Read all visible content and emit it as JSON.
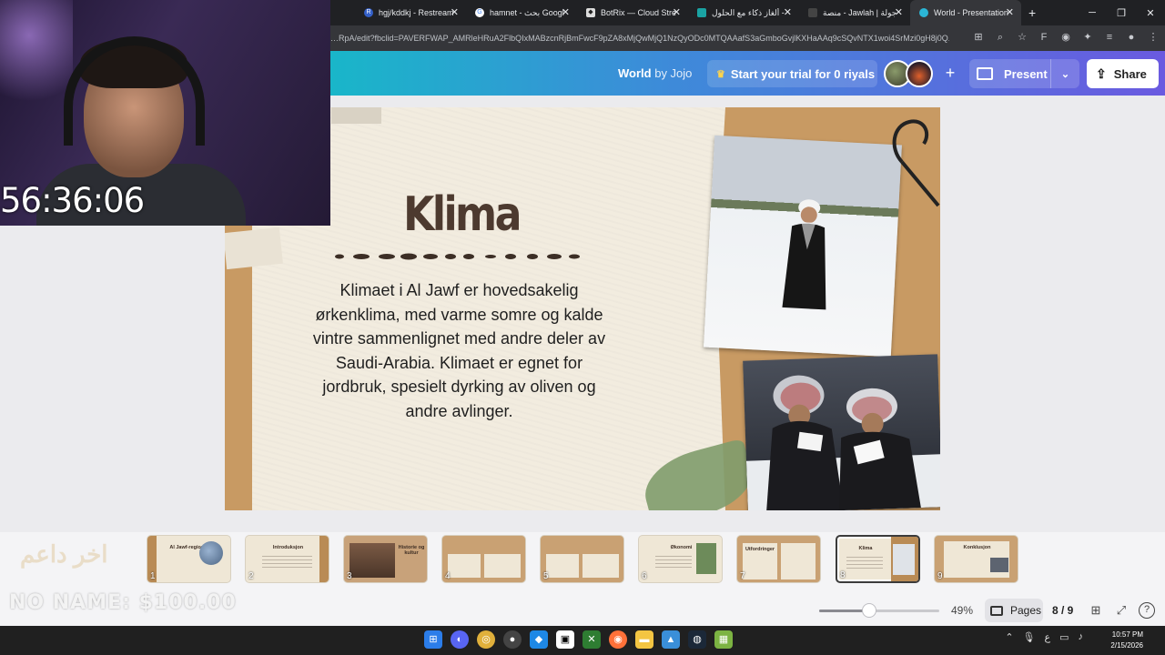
{
  "browser": {
    "tabs": [
      {
        "label": "",
        "icon": "tab-icon"
      },
      {
        "label": "hgj/kddkj - Restream",
        "icon": "restream-icon"
      },
      {
        "label": "hamnet - بحث Googl",
        "icon": "google-icon"
      },
      {
        "label": "BotRix — Cloud Stre",
        "icon": "botrix-icon"
      },
      {
        "label": "ألغاز ذكاء مع الحلول -",
        "icon": "page-icon"
      },
      {
        "label": "منصة - Jawlah | جولة",
        "icon": "jawlah-icon"
      },
      {
        "label": "World - Presentation",
        "icon": "canva-icon"
      }
    ],
    "url": "…RpA/edit?fbclid=PAVERFWAP_AMRleHRuA2FlbQIxMABzcnRjBmFwcF9pZA8xMjQwMjQ1NzQyODc0MTQAAafS3aGmboGvjlKXHaAAq9cSQvNTX1woi4SrMzi0gH8j0Q..."
  },
  "header": {
    "doc_title": "World",
    "doc_by": "by Jojo",
    "trial_label": "Start your trial for 0 riyals",
    "present_label": "Present",
    "share_label": "Share"
  },
  "slide": {
    "title": "Klima",
    "body": "Klimaet i Al Jawf er hovedsakelig ørkenklima, med varme somre og kalde vintre sammenlignet med andre deler av Saudi-Arabia. Klimaet er egnet for jordbruk, spesielt dyrking av oliven og andre avlinger."
  },
  "thumbnails": [
    {
      "num": "1",
      "title": "Al Jawf-regionen"
    },
    {
      "num": "2",
      "title": "Introduksjon"
    },
    {
      "num": "3",
      "title": "Historie og kultur"
    },
    {
      "num": "4",
      "title": ""
    },
    {
      "num": "5",
      "title": ""
    },
    {
      "num": "6",
      "title": "Økonomi"
    },
    {
      "num": "7",
      "title": "Utfordringer"
    },
    {
      "num": "8",
      "title": "Klima"
    },
    {
      "num": "9",
      "title": "Konklusjon"
    }
  ],
  "bottom": {
    "zoom": "49%",
    "zoom_fraction": 0.42,
    "pages_label": "Pages",
    "page_count": "8 / 9"
  },
  "overlay": {
    "timer": "56:36:06",
    "arabic": "اخر داعم",
    "donation": "NO NAME: $100.00"
  },
  "taskbar": {
    "time": "10:57 PM",
    "date": "2/15/2026"
  },
  "colors": {
    "header_gradient_start": "#19b6c9",
    "header_gradient_end": "#6a5ae0",
    "title_brown": "#4d3a2f",
    "kraft": "#c89a63"
  }
}
